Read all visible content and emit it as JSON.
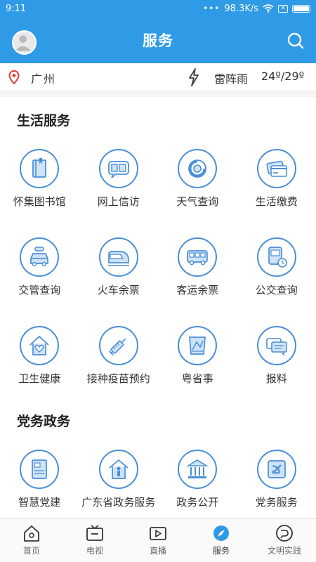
{
  "status": {
    "time": "9:11",
    "dots": "•••",
    "speed": "98.3K/s"
  },
  "header": {
    "title": "服务",
    "avatar_icon": "user-avatar",
    "search_icon": "search-icon"
  },
  "location": {
    "city": "广州",
    "condition": "雷阵雨",
    "temperature": "24º/29º"
  },
  "sections": [
    {
      "title": "生活服务",
      "items": [
        {
          "label": "怀集图书馆",
          "icon": "library-book-icon"
        },
        {
          "label": "网上信访",
          "icon": "petition-icon"
        },
        {
          "label": "天气查询",
          "icon": "weather-icon"
        },
        {
          "label": "生活缴费",
          "icon": "payment-card-icon"
        },
        {
          "label": "交管查询",
          "icon": "traffic-car-icon"
        },
        {
          "label": "火车余票",
          "icon": "train-icon"
        },
        {
          "label": "客运余票",
          "icon": "bus-icon"
        },
        {
          "label": "公交查询",
          "icon": "bus-clock-icon"
        },
        {
          "label": "卫生健康",
          "icon": "health-house-icon"
        },
        {
          "label": "接种疫苗预约",
          "icon": "vaccine-syringe-icon"
        },
        {
          "label": "粤省事",
          "icon": "yue-app-icon"
        },
        {
          "label": "报料",
          "icon": "report-chat-icon"
        }
      ]
    },
    {
      "title": "党务政务",
      "items": [
        {
          "label": "智慧党建",
          "icon": "party-building-icon"
        },
        {
          "label": "广东省政务服务",
          "icon": "gov-service-house-icon"
        },
        {
          "label": "政务公开",
          "icon": "government-building-icon"
        },
        {
          "label": "党务服务",
          "icon": "party-emblem-icon"
        }
      ]
    }
  ],
  "bottom_nav": [
    {
      "label": "首页",
      "icon": "home-icon"
    },
    {
      "label": "电视",
      "icon": "tv-icon"
    },
    {
      "label": "直播",
      "icon": "live-video-icon"
    },
    {
      "label": "服务",
      "icon": "compass-icon",
      "active": true
    },
    {
      "label": "文明实践",
      "icon": "civilization-icon"
    }
  ],
  "colors": {
    "primary": "#2f9ae6",
    "icon_stroke": "#4a8fd6",
    "active_nav": "#2f9ae6"
  }
}
